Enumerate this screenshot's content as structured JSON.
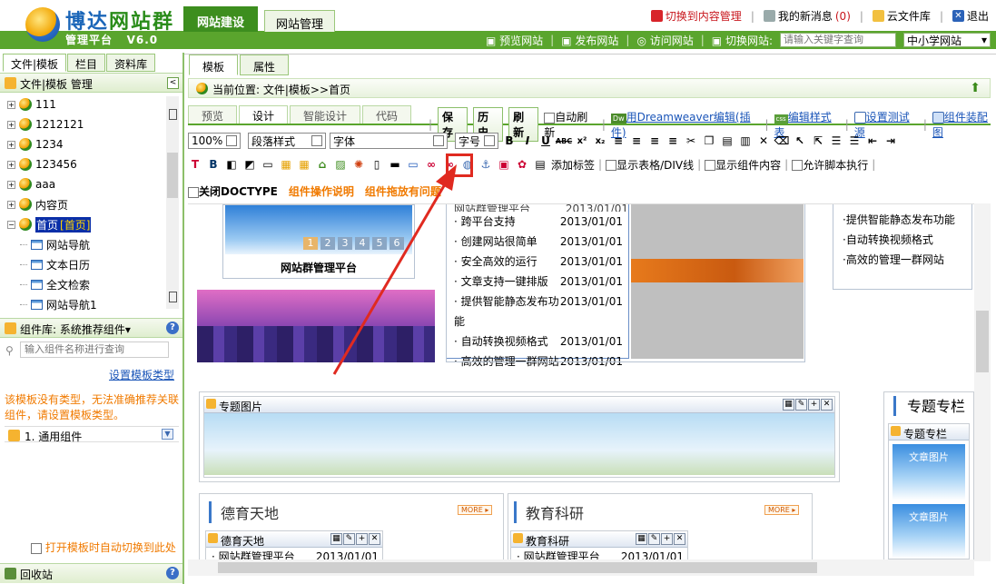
{
  "header": {
    "brand_main_a": "博达",
    "brand_main_b": "网站群",
    "brand_sub": "管理平台",
    "version": "V6.0",
    "tab_build": "网站建设",
    "tab_manage": "网站管理",
    "switch_content": "切换到内容管理",
    "messages": "我的新消息",
    "messages_count": "(0)",
    "cloud_lib": "云文件库",
    "logout": "退出",
    "preview_site": "预览网站",
    "publish_site": "发布网站",
    "visit_site": "访问网站",
    "switch_site_label": "切换网站:",
    "search_placeholder": "请输入关键字查询",
    "site_selected": "中小学网站"
  },
  "left": {
    "tabs": [
      "文件|模板",
      "栏目",
      "资料库"
    ],
    "tree_header": "文件|模板 管理",
    "tree": [
      {
        "label": "111",
        "type": "ball"
      },
      {
        "label": "1212121",
        "type": "ball"
      },
      {
        "label": "1234",
        "type": "ball"
      },
      {
        "label": "123456",
        "type": "ball"
      },
      {
        "label": "aaa",
        "type": "ball"
      },
      {
        "label": "内容页",
        "type": "ball"
      },
      {
        "label": "首页",
        "type": "ball",
        "selected": true,
        "badge": "[首页]"
      },
      {
        "label": "网站导航",
        "type": "page"
      },
      {
        "label": "文本日历",
        "type": "page"
      },
      {
        "label": "全文检索",
        "type": "page"
      },
      {
        "label": "网站导航1",
        "type": "page"
      }
    ],
    "comp_header": "组件库: 系统推荐组件▾",
    "comp_search_placeholder": "输入组件名称进行查询",
    "set_type": "设置模板类型",
    "warning": "该模板没有类型，无法准确推荐关联组件，请设置模板类型。",
    "category": "1.  通用组件",
    "auto_switch": "打开模板时自动切换到此处",
    "recycle": "回收站"
  },
  "main": {
    "tabs": [
      "模板",
      "属性"
    ],
    "crumb": "当前位置: 文件|模板>>首页",
    "view_tabs": [
      "预览",
      "设计",
      "智能设计",
      "代码"
    ],
    "save": "保存",
    "history": "历史",
    "refresh": "刷新",
    "auto_refresh": "自动刷新",
    "dw_edit": "用Dreamweaver编辑",
    "dw_plugin": "(插件)",
    "edit_styles": "编辑样式表",
    "set_test_src": "设置测试源",
    "comp_map": "组件装配图",
    "zoom": "100%",
    "para_style": "段落样式",
    "font": "字体",
    "font_size": "字号",
    "add_tag": "添加标签",
    "show_table": "显示表格/DIV线",
    "show_comp": "显示组件内容",
    "allow_script": "允许脚本执行",
    "close_doctype": "关闭DOCTYPE",
    "comp_help": "组件操作说明",
    "comp_issue": "组件拖放有问题"
  },
  "canvas": {
    "banner_title": "网站群管理平台",
    "pager": [
      "1",
      "2",
      "3",
      "4",
      "5",
      "6"
    ],
    "news_partial": "网站群管理平台",
    "news": [
      {
        "title": "跨平台支持",
        "date": "2013/01/01"
      },
      {
        "title": "创建网站很简单",
        "date": "2013/01/01"
      },
      {
        "title": "安全高效的运行",
        "date": "2013/01/01"
      },
      {
        "title": "文章支持一键排版",
        "date": "2013/01/01"
      },
      {
        "title": "提供智能静态发布功能",
        "date": "2013/01/01"
      },
      {
        "title": "自动转换视频格式",
        "date": "2013/01/01"
      },
      {
        "title": "高效的管理一群网站",
        "date": "2013/01/01"
      }
    ],
    "right_list": [
      "提供智能静态发布功能",
      "自动转换视频格式",
      "高效的管理一群网站"
    ],
    "special_pic": "专题图片",
    "special_col": "专题专栏",
    "special_col_panel": "专题专栏",
    "moral": "德育天地",
    "moral_panel": "德育天地",
    "edu": "教育科研",
    "edu_panel": "教育科研",
    "more": "MORE ▸",
    "row_title": "网站群管理平台",
    "row_date": "2013/01/01",
    "thumb_text": "文章图片"
  }
}
